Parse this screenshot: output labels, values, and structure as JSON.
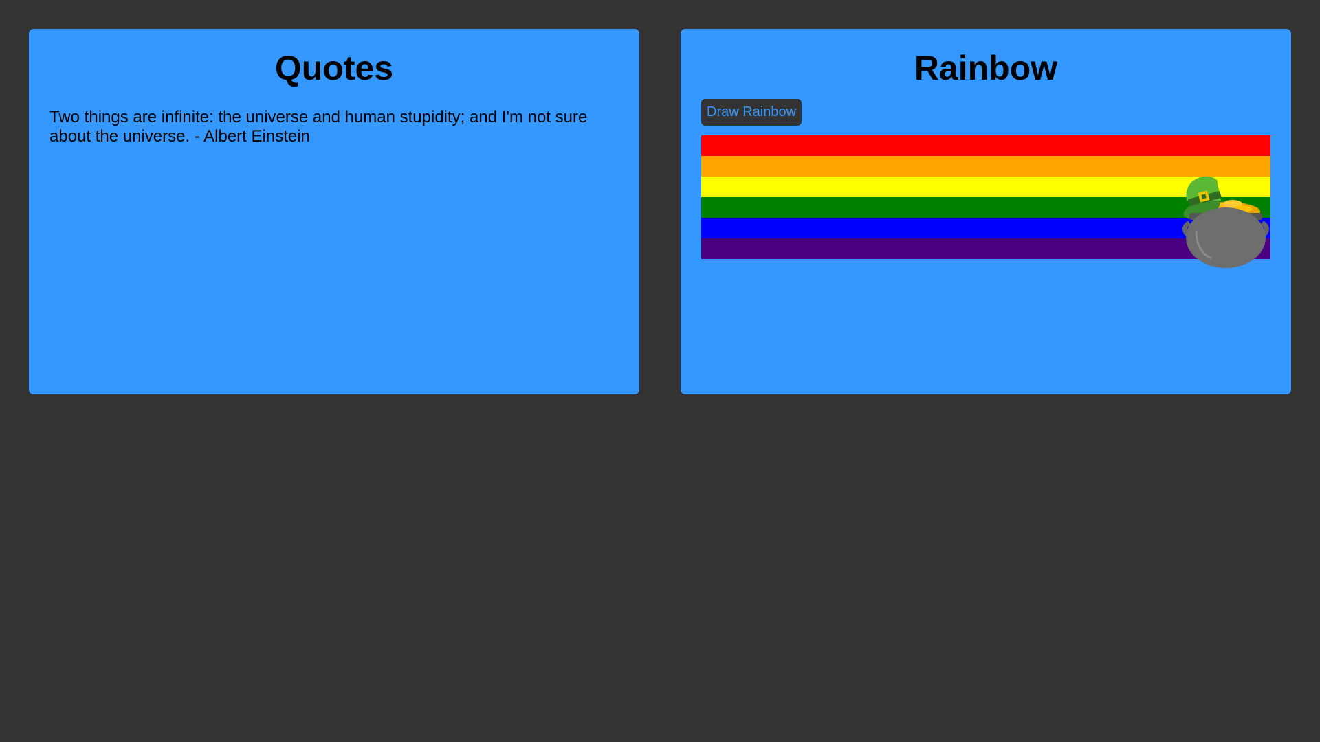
{
  "quotes_panel": {
    "title": "Quotes",
    "quote": "Two things are infinite: the universe and human stupidity; and I'm not sure about the universe. - Albert Einstein"
  },
  "rainbow_panel": {
    "title": "Rainbow",
    "draw_button_label": "Draw Rainbow",
    "bands": [
      "#ff0000",
      "#ffa500",
      "#ffff00",
      "#008000",
      "#0000ff",
      "#4b0082"
    ],
    "decoration_icon": "pot-of-gold-icon"
  },
  "colors": {
    "background": "#333333",
    "card": "#3498ff",
    "button_bg": "#333333",
    "button_text": "#3498ff"
  }
}
